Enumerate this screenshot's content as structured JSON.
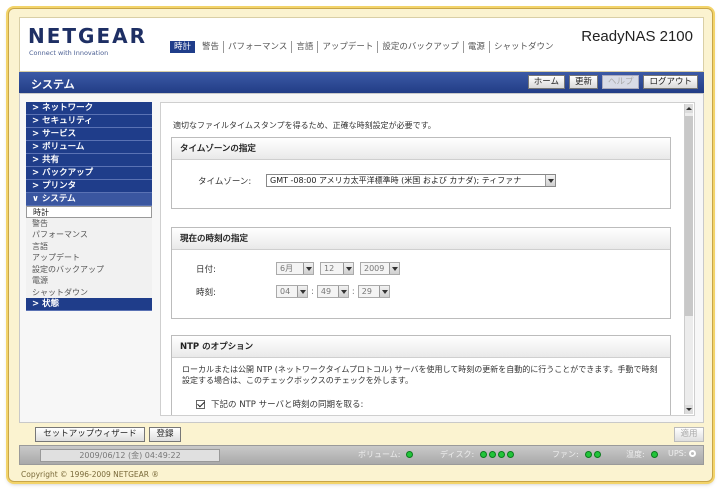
{
  "header": {
    "logo": "NETGEAR",
    "logo_tagline": "Connect with Innovation",
    "product": "ReadyNAS 2100",
    "tabs": [
      "時計",
      "警告",
      "パフォーマンス",
      "言語",
      "アップデート",
      "設定のバックアップ",
      "電源",
      "シャットダウン"
    ]
  },
  "titlebar": {
    "title": "システム",
    "buttons": {
      "home": "ホーム",
      "refresh": "更新",
      "help": "ヘルプ",
      "logout": "ログアウト"
    }
  },
  "sidebar": {
    "categories": [
      "> ネットワーク",
      "> セキュリティ",
      "> サービス",
      "> ボリューム",
      "> 共有",
      "> バックアップ",
      "> プリンタ",
      "∨ システム"
    ],
    "system_items": [
      "時計",
      "警告",
      "パフォーマンス",
      "言語",
      "アップデート",
      "設定のバックアップ",
      "電源",
      "シャットダウン"
    ],
    "status_category": "> 状態"
  },
  "main": {
    "intro": "適切なファイルタイムスタンプを得るため、正確な時刻設定が必要です。",
    "timezone": {
      "title": "タイムゾーンの指定",
      "label": "タイムゾーン:",
      "value": "GMT -08:00 アメリカ太平洋標準時 (米国 および カナダ); ティファナ"
    },
    "current_time": {
      "title": "現在の時刻の指定",
      "date_label": "日付:",
      "month": "6月",
      "day": "12",
      "year": "2009",
      "time_label": "時刻:",
      "hour": "04",
      "minute": "49",
      "second": "29"
    },
    "ntp": {
      "title": "NTP のオプション",
      "description": "ローカルまたは公開 NTP (ネットワークタイムプロトコル) サーバを使用して時刻の更新を自動的に行うことができます。手動で時刻設定する場合は、このチェックボックスのチェックを外します。",
      "checkbox_label": "下記の NTP サーバと時刻の同期を取る:",
      "checked": true
    }
  },
  "bottombar": {
    "wizard": "セットアップウィザード",
    "register": "登録",
    "apply": "適用"
  },
  "statusbar": {
    "datetime": "2009/06/12 (金) 04:49:22",
    "volume_label": "ボリューム:",
    "disk_label": "ディスク:",
    "fan_label": "ファン:",
    "temp_label": "温度:",
    "ups_label": "UPS:",
    "disk_dot_count": 4,
    "fan_dot_count": 2,
    "status_color": "#22c43a"
  },
  "footer": {
    "copyright": "Copyright © 1996-2009 NETGEAR ®"
  }
}
